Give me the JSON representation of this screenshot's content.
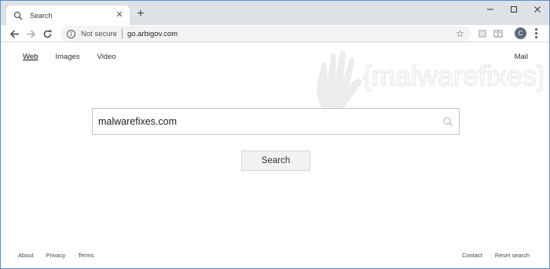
{
  "browser": {
    "tab": {
      "title": "Search"
    },
    "new_tab_symbol": "+",
    "address_bar": {
      "security_label": "Not secure",
      "url": "go.arbigov.com"
    },
    "profile_initial": "C"
  },
  "page": {
    "watermark_text": "{malwarefixes}",
    "top_nav": {
      "links": [
        "Web",
        "Images",
        "Video"
      ],
      "active": "Web",
      "mail": "Mail"
    },
    "search": {
      "value": "malwarefixes.com",
      "button_label": "Search"
    },
    "footer": {
      "left": [
        "About",
        "Privacy",
        "Terms"
      ],
      "right": [
        "Contact",
        "Reset search"
      ]
    }
  },
  "colors": {
    "window_border": "#5b8fc9",
    "tabstrip": "#dee1e6",
    "omnibox": "#f1f3f4",
    "button_bg": "#f2f2f2"
  }
}
